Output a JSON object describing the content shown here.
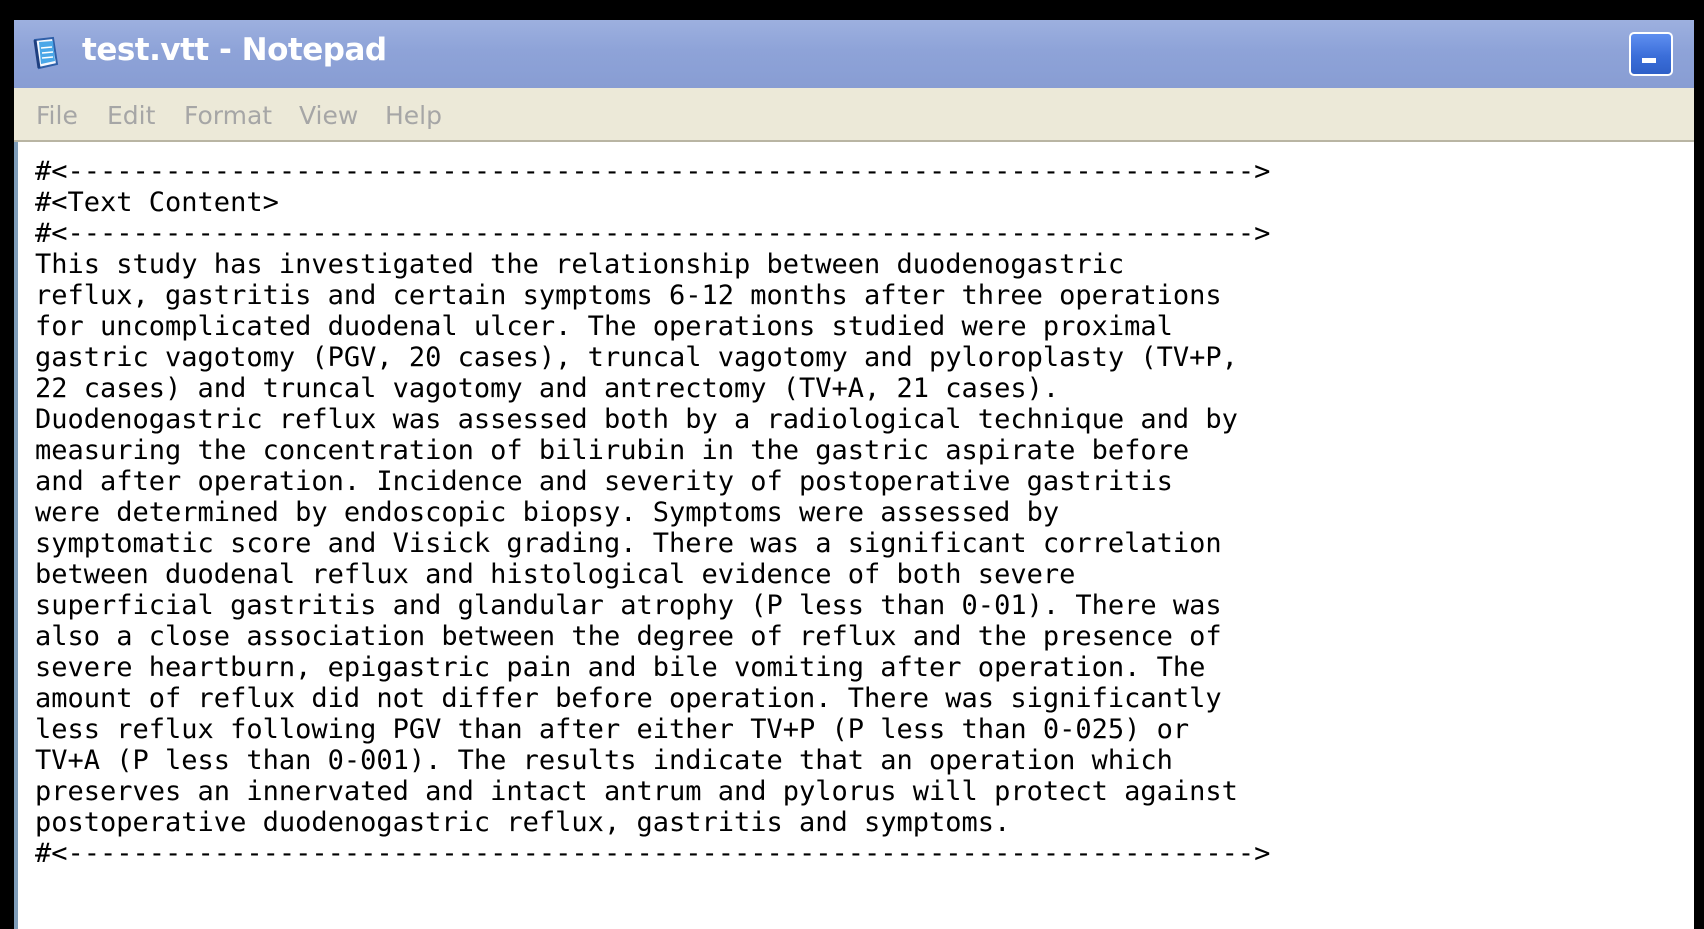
{
  "window": {
    "title": "test.vtt - Notepad",
    "icon": "notepad-icon",
    "minimize_icon": "minimize-icon"
  },
  "menu": {
    "items": [
      "File",
      "Edit",
      "Format",
      "View",
      "Help"
    ]
  },
  "editor": {
    "lines": [
      "#<------------------------------------------------------------------------->",
      "#<Text Content>",
      "#<------------------------------------------------------------------------->",
      "This study has investigated the relationship between duodenogastric",
      "reflux, gastritis and certain symptoms 6-12 months after three operations",
      "for uncomplicated duodenal ulcer. The operations studied were proximal",
      "gastric vagotomy (PGV, 20 cases), truncal vagotomy and pyloroplasty (TV+P,",
      "22 cases) and truncal vagotomy and antrectomy (TV+A, 21 cases).",
      "Duodenogastric reflux was assessed both by a radiological technique and by",
      "measuring the concentration of bilirubin in the gastric aspirate before",
      "and after operation. Incidence and severity of postoperative gastritis",
      "were determined by endoscopic biopsy. Symptoms were assessed by",
      "symptomatic score and Visick grading. There was a significant correlation",
      "between duodenal reflux and histological evidence of both severe",
      "superficial gastritis and glandular atrophy (P less than 0-01). There was",
      "also a close association between the degree of reflux and the presence of",
      "severe heartburn, epigastric pain and bile vomiting after operation. The",
      "amount of reflux did not differ before operation. There was significantly",
      "less reflux following PGV than after either TV+P (P less than 0-025) or",
      "TV+A (P less than 0-001). The results indicate that an operation which",
      "preserves an innervated and intact antrum and pylorus will protect against",
      "postoperative duodenogastric reflux, gastritis and symptoms.",
      "#<------------------------------------------------------------------------->"
    ]
  },
  "colors": {
    "titlebar": "#8ea3d8",
    "menubar": "#ece9d8",
    "menu_text_disabled": "#a6a6a6",
    "edit_border": "#7f9db9"
  }
}
